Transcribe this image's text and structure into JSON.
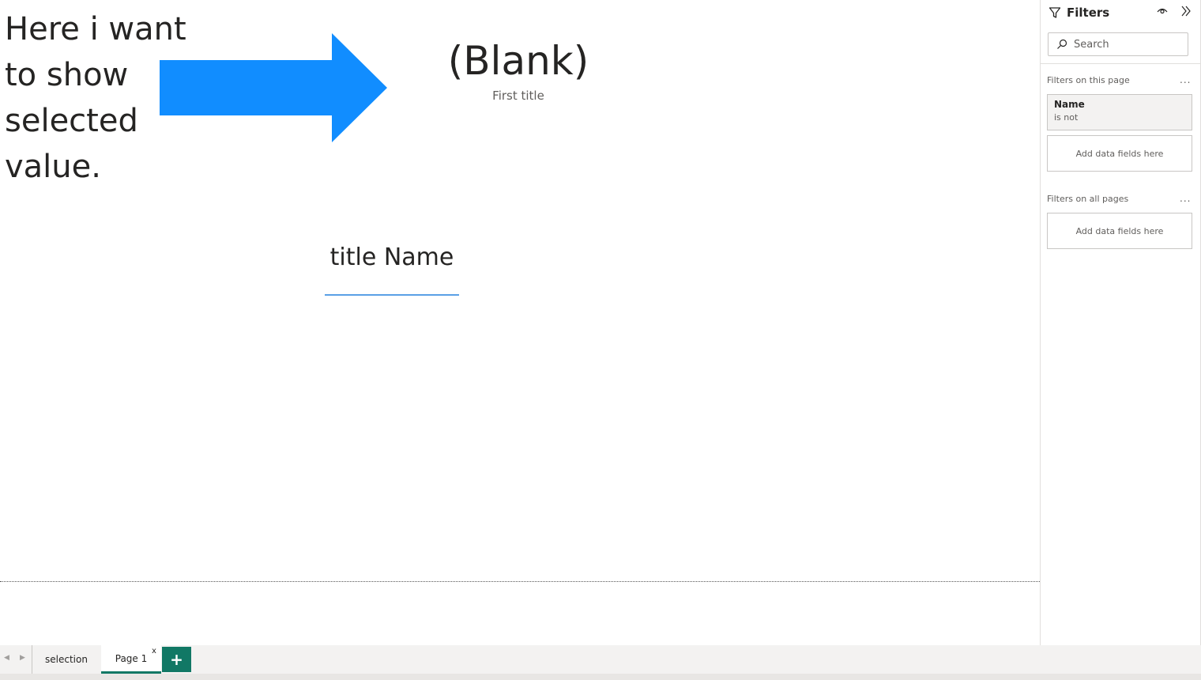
{
  "canvas": {
    "annotation_text": "Here  i want\nto show\nselected\nvalue.",
    "arrow_color": "#118dff",
    "card": {
      "value": "(Blank)",
      "label": "First title"
    },
    "slicer": {
      "title": "title Name"
    }
  },
  "filters_pane": {
    "title": "Filters",
    "search_placeholder": "Search",
    "section_this_page": "Filters on this page",
    "section_all_pages": "Filters on all pages",
    "more_label": "...",
    "filter_card": {
      "field": "Name",
      "condition": "is not"
    },
    "drop_zone_label": "Add data fields here"
  },
  "tabs": {
    "items": [
      "selection",
      "Page 1"
    ],
    "active": "Page 1",
    "close_label": "x",
    "add_label": "+",
    "accent": "#117865"
  }
}
